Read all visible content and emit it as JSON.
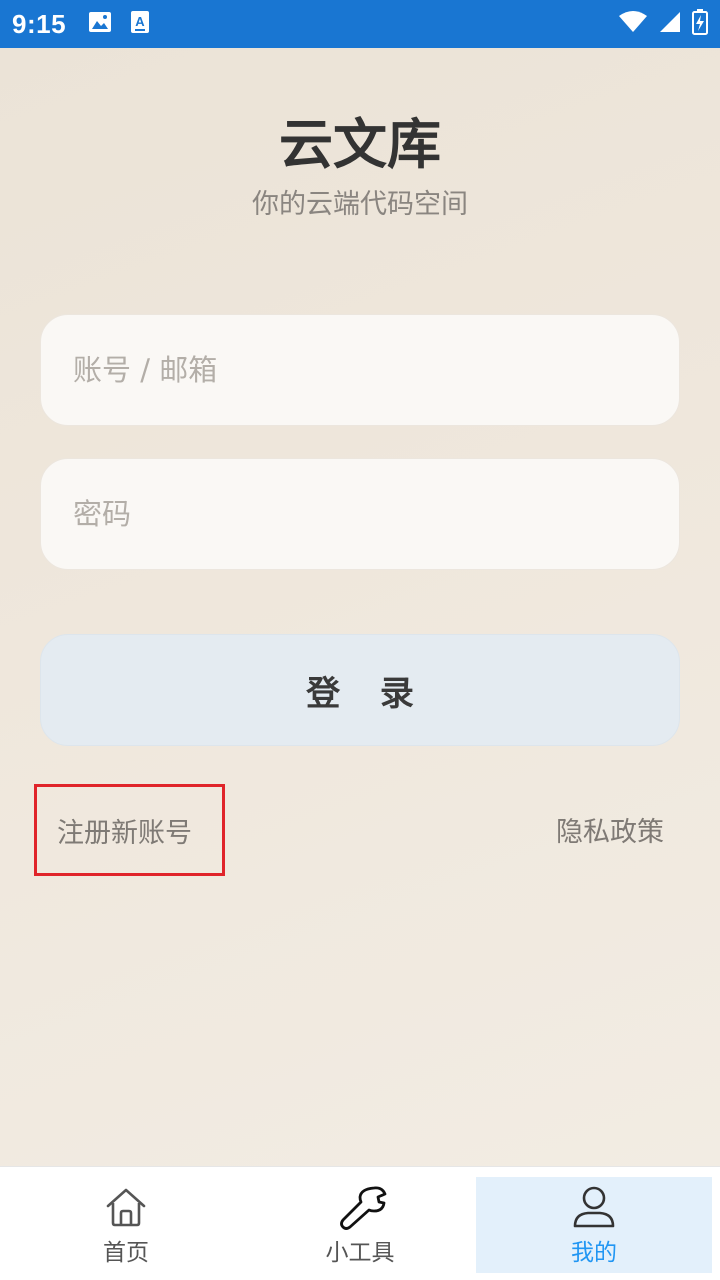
{
  "status_bar": {
    "time": "9:15",
    "left_icons": [
      "image-icon",
      "text-a-icon"
    ],
    "right_icons": [
      "wifi-icon",
      "signal-icon",
      "battery-icon"
    ],
    "background": "#1976d2"
  },
  "header": {
    "title": "云文库",
    "subtitle": "你的云端代码空间"
  },
  "form": {
    "account_placeholder": "账号 / 邮箱",
    "account_value": "",
    "password_placeholder": "密码",
    "password_value": "",
    "login_label": "登 录"
  },
  "links": {
    "register": "注册新账号",
    "privacy": "隐私政策"
  },
  "bottom_nav": {
    "items": [
      {
        "label": "首页",
        "icon": "home-icon",
        "selected": false
      },
      {
        "label": "小工具",
        "icon": "wrench-icon",
        "selected": false
      },
      {
        "label": "我的",
        "icon": "user-icon",
        "selected": true
      }
    ],
    "selected_color": "#2196f3",
    "selected_background": "#e3f0fb"
  },
  "colors": {
    "highlight_border": "#e0242a"
  }
}
